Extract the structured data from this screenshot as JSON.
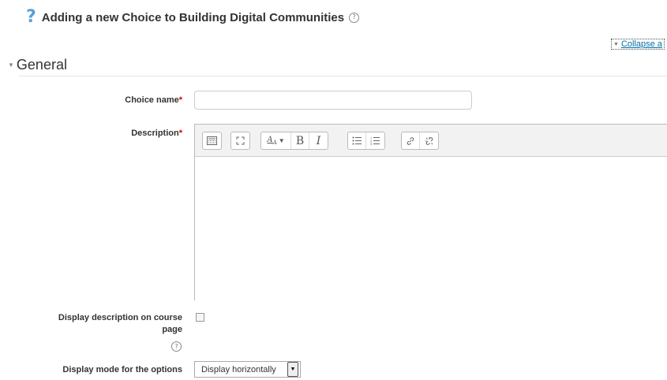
{
  "page_heading": {
    "icon": "help-question-icon",
    "title": "Adding a new Choice to Building Digital Communities"
  },
  "collapse_all": {
    "label": "Collapse a"
  },
  "section": {
    "title": "General"
  },
  "fields": {
    "choice_name": {
      "label": "Choice name",
      "required_mark": "*",
      "value": ""
    },
    "description": {
      "label": "Description",
      "required_mark": "*",
      "value": ""
    },
    "display_description": {
      "label_line1": "Display description on course",
      "label_line2": "page",
      "checked": false
    },
    "display_mode": {
      "label": "Display mode for the options",
      "selected": "Display horizontally"
    }
  },
  "editor_toolbar": {
    "groups": [
      [
        "toolbar-toggle-icon"
      ],
      [
        "fullscreen-icon"
      ],
      [
        "text-style-icon",
        "bold-icon",
        "italic-icon"
      ],
      [
        "bullet-list-icon",
        "numbered-list-icon"
      ],
      [
        "link-icon",
        "unlink-icon"
      ]
    ],
    "bold_glyph": "B",
    "italic_glyph": "I"
  }
}
